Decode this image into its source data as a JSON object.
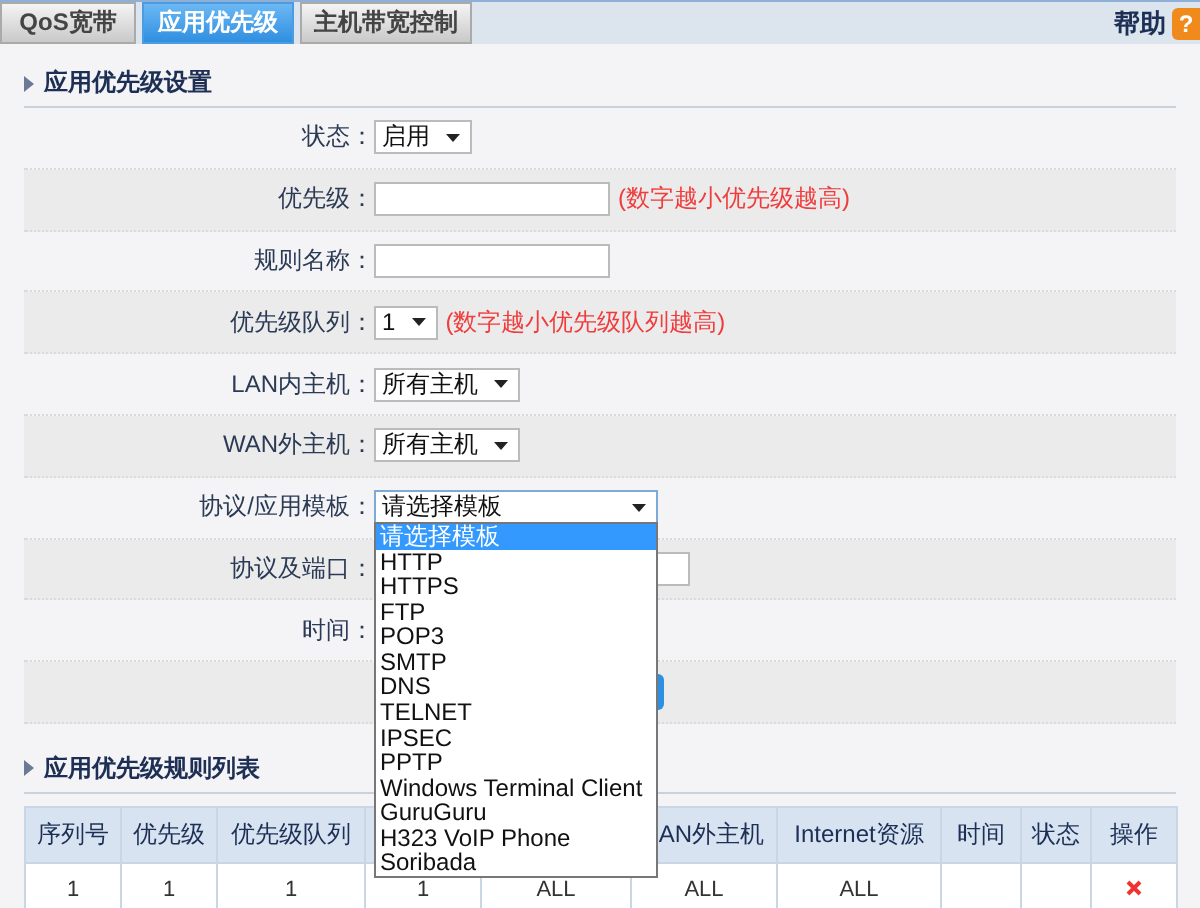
{
  "tabs": [
    {
      "label": "QoS宽带",
      "selected": false
    },
    {
      "label": "应用优先级",
      "selected": true
    },
    {
      "label": "主机带宽控制",
      "selected": false
    }
  ],
  "help": {
    "label": "帮助",
    "icon": "?"
  },
  "settings": {
    "title": "应用优先级设置",
    "rows": [
      {
        "kind": "select",
        "label": "状态：",
        "value": "启用"
      },
      {
        "kind": "input",
        "label": "优先级：",
        "hint": "(数字越小优先级越高)"
      },
      {
        "kind": "input",
        "label": "规则名称："
      },
      {
        "kind": "select",
        "label": "优先级队列：",
        "value": "1",
        "hint": "(数字越小优先级队列越高)"
      },
      {
        "kind": "select",
        "label": "LAN内主机：",
        "value": "所有主机"
      },
      {
        "kind": "select",
        "label": "WAN外主机：",
        "value": "所有主机"
      },
      {
        "kind": "open_select",
        "label": "协议/应用模板：",
        "value": "请选择模板",
        "options": [
          {
            "label": "请选择模板",
            "selected": true
          },
          {
            "label": "HTTP",
            "selected": false
          },
          {
            "label": "HTTPS",
            "selected": false
          },
          {
            "label": "FTP",
            "selected": false
          },
          {
            "label": "POP3",
            "selected": false
          },
          {
            "label": "SMTP",
            "selected": false
          },
          {
            "label": "DNS",
            "selected": false
          },
          {
            "label": "TELNET",
            "selected": false
          },
          {
            "label": "IPSEC",
            "selected": false
          },
          {
            "label": "PPTP",
            "selected": false
          },
          {
            "label": "Windows Terminal Client",
            "selected": false
          },
          {
            "label": "GuruGuru",
            "selected": false
          },
          {
            "label": "H323 VoIP Phone",
            "selected": false
          },
          {
            "label": "Soribada",
            "selected": false
          }
        ]
      },
      {
        "kind": "input",
        "label": "协议及端口："
      },
      {
        "kind": "label",
        "label": "时间："
      },
      {
        "kind": "button"
      }
    ]
  },
  "rules": {
    "title": "应用优先级规则列表",
    "columns": [
      {
        "label": "序列号"
      },
      {
        "label": "优先级"
      },
      {
        "label": "优先级队列"
      },
      {},
      {},
      {
        "label": "AN外主机"
      },
      {
        "label": "Internet资源"
      },
      {
        "label": "时间"
      },
      {
        "label": "状态"
      },
      {
        "label": "操作"
      }
    ],
    "rows": [
      {
        "cells": [
          {
            "text": "1"
          },
          {
            "text": "1"
          },
          {
            "text": "1"
          },
          {
            "text": "1"
          },
          {
            "text": "ALL"
          },
          {
            "text": "ALL"
          },
          {
            "text": "ALL"
          },
          {},
          {},
          {
            "kind": "delete"
          }
        ]
      }
    ]
  }
}
